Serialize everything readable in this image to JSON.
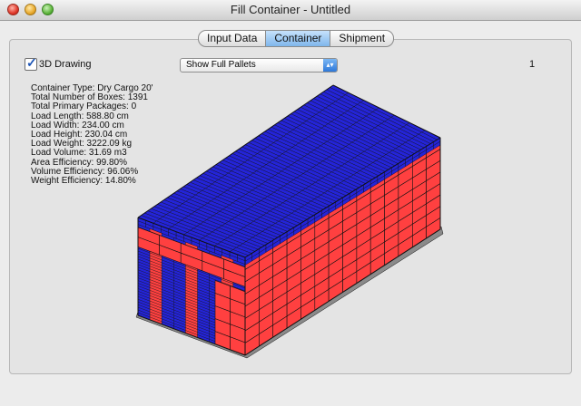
{
  "window": {
    "title": "Fill Container - Untitled"
  },
  "tabs": [
    {
      "label": "Input Data",
      "active": false
    },
    {
      "label": "Container",
      "active": true
    },
    {
      "label": "Shipment",
      "active": false
    }
  ],
  "options": {
    "drawing_label": "3D Drawing",
    "drawing_checked": true,
    "pallet_select_value": "Show Full Pallets",
    "page_number": "1"
  },
  "stats": [
    "Container Type: Dry Cargo 20'",
    "Total Number of Boxes: 1391",
    "Total Primary Packages: 0",
    "Load Length: 588.80 cm",
    "Load Width: 234.00 cm",
    "Load Height: 230.04 cm",
    "Load Weight: 3222.09 kg",
    "Load Volume: 31.69 m3",
    "Area Efficiency: 99.80%",
    "Volume Efficiency: 96.06%",
    "Weight Efficiency: 14.80%"
  ],
  "colors": {
    "box_red": "#ff4040",
    "box_blue": "#2424d8",
    "outline": "#111111"
  }
}
